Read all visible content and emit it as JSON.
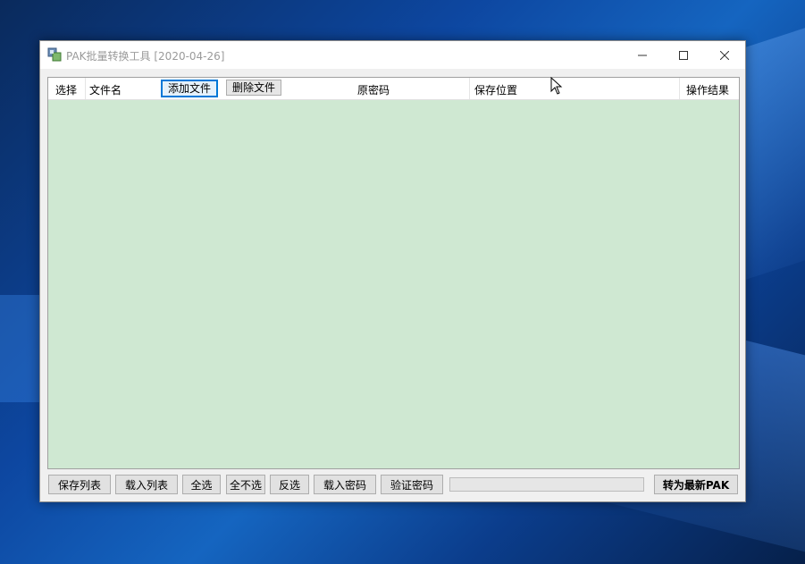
{
  "window": {
    "title": "PAK批量转换工具 [2020-04-26]"
  },
  "columns": {
    "select": "选择",
    "filename": "文件名",
    "original_password": "原密码",
    "save_location": "保存位置",
    "result": "操作结果"
  },
  "header_buttons": {
    "add_file": "添加文件",
    "delete_file": "删除文件"
  },
  "toolbar": {
    "save_list": "保存列表",
    "load_list": "载入列表",
    "select_all": "全选",
    "select_none": "全不选",
    "invert_selection": "反选",
    "load_password": "载入密码",
    "verify_password": "验证密码",
    "convert": "转为最新PAK"
  },
  "progress": {
    "value": 0
  },
  "icons": [
    "app-icon",
    "minimize-icon",
    "maximize-icon",
    "close-icon",
    "cursor-icon"
  ],
  "colors": {
    "list_background": "#cfe8d2",
    "active_border": "#0078d7"
  }
}
